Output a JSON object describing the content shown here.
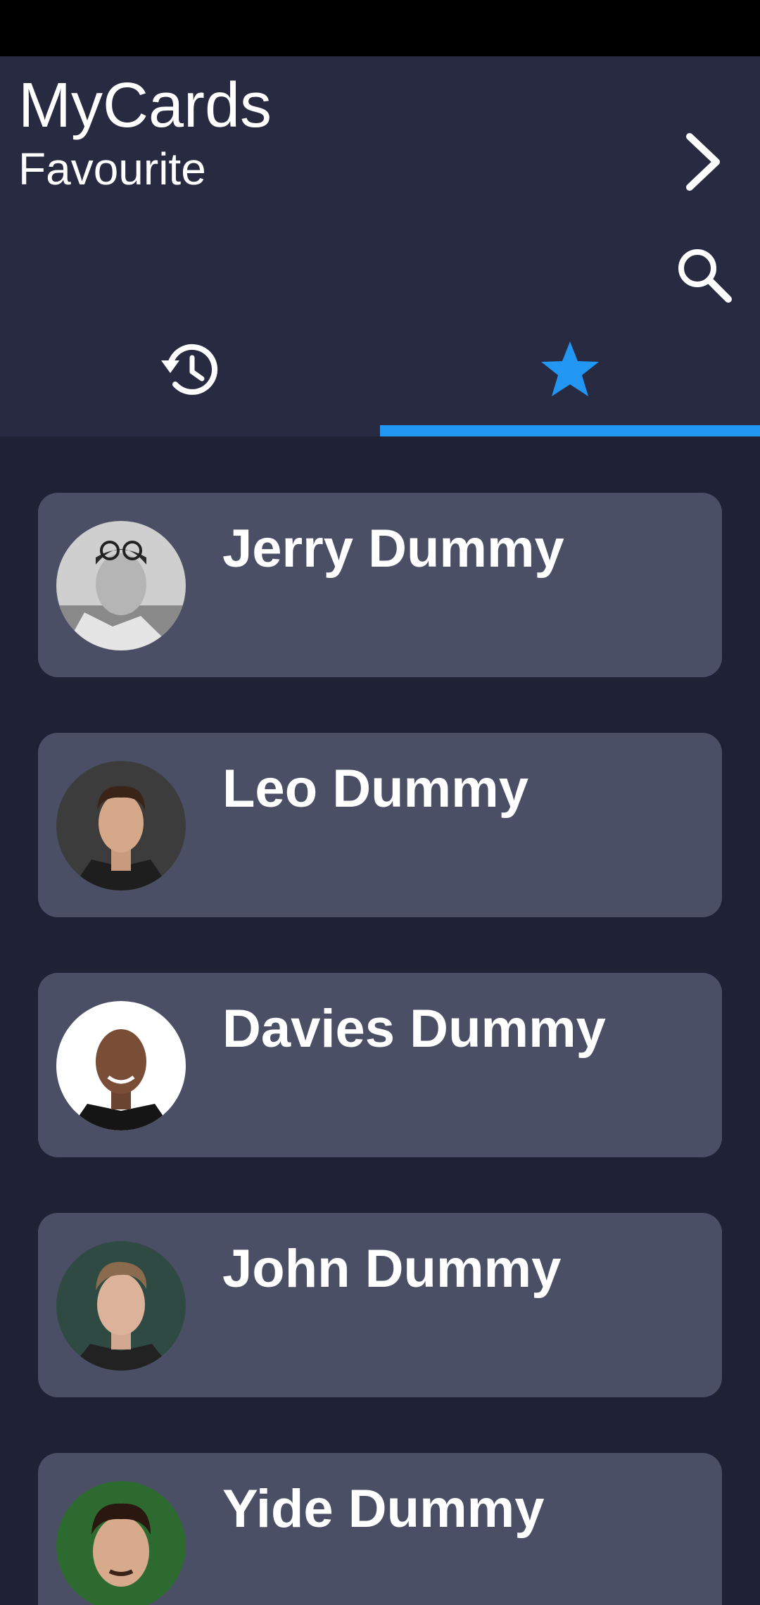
{
  "app": {
    "title": "MyCards",
    "subtitle": "Favourite"
  },
  "icons": {
    "forward": "chevron-right-icon",
    "search": "search-icon",
    "history_tab": "history-icon",
    "favourite_tab": "star-icon"
  },
  "tabs": [
    {
      "id": "history",
      "active": false
    },
    {
      "id": "favourite",
      "active": true
    }
  ],
  "colors": {
    "accent": "#2196f3",
    "header_bg": "#282a42",
    "page_bg": "#1f2135",
    "card_bg": "#4b4f66",
    "text": "#ffffff"
  },
  "contacts": [
    {
      "name": "Jerry Dummy"
    },
    {
      "name": "Leo Dummy"
    },
    {
      "name": "Davies Dummy"
    },
    {
      "name": "John Dummy"
    },
    {
      "name": "Yide Dummy"
    }
  ]
}
